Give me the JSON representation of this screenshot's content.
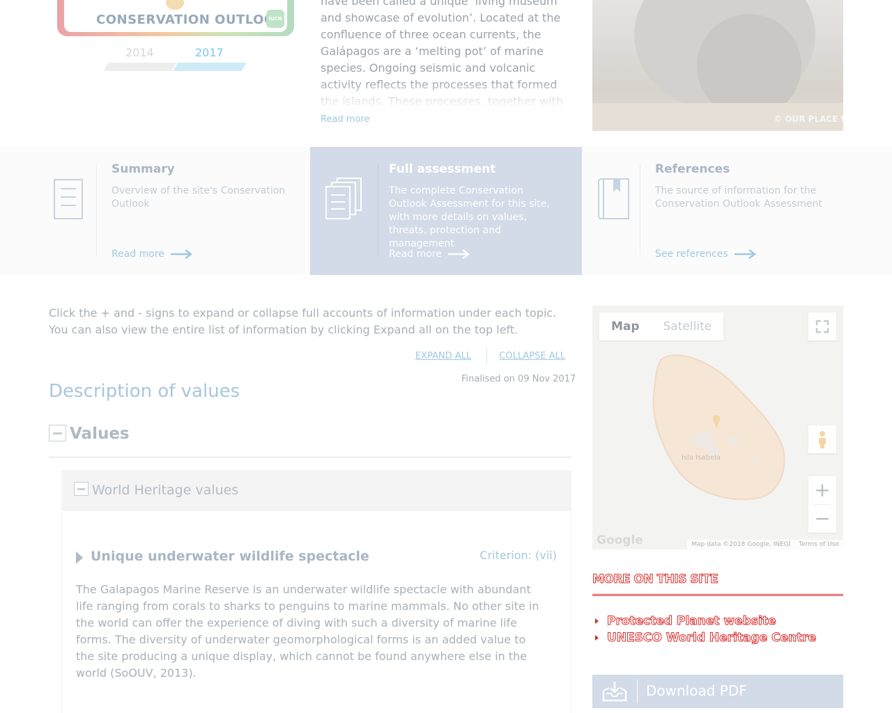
{
  "outlook": {
    "badge_title": "CONSERVATION OUTLOOK",
    "badge_logo": "IUCN",
    "years": [
      "2014",
      "2017"
    ],
    "selected_year": "2017"
  },
  "intro": {
    "text": "have been called a unique ‘living museum and showcase of evolution’. Located at the confluence of three ocean currents, the Galápagos are a ‘melting pot’ of marine species. Ongoing seismic and volcanic activity reflects the processes that formed the islands. These processes, together with",
    "read_more": "Read more"
  },
  "photo": {
    "credit": "© OUR PLACE WO"
  },
  "tabs": [
    {
      "title": "Summary",
      "desc": "Overview of the site's Conservation Outlook",
      "link": "Read more",
      "icon": "document-icon",
      "active": false
    },
    {
      "title": "Full assessment",
      "desc": "The complete Conservation Outlook Assessment for this site, with more details on values, threats, protection and management",
      "link": "Read more",
      "icon": "documents-stack-icon",
      "active": true
    },
    {
      "title": "References",
      "desc": "The source of information for the Conservation Outlook Assessment",
      "link": "See references",
      "icon": "book-icon",
      "active": false
    }
  ],
  "instructions": "Click the + and - signs to expand or collapse full accounts of information under each topic. You can also view the entire list of information by clicking Expand all on the top left.",
  "toggles": {
    "expand": "EXPAND ALL",
    "collapse": "COLLAPSE ALL"
  },
  "finalised": "Finalised on 09 Nov 2017",
  "section_heading": "Description of values",
  "values": {
    "title": "Values",
    "group_title": "World Heritage values",
    "item": {
      "title": "Unique underwater wildlife spectacle",
      "criterion": "Criterion: (vii)",
      "body": "The Galapagos Marine Reserve is an underwater wildlife spectacle with abundant life ranging from corals to sharks to penguins to marine mammals. No other site in the world can offer the experience of diving with such a diversity of marine life forms. The diversity of underwater geomorphological forms is an added value to the site producing a unique display, which cannot be found anywhere else in the world (SoOUV, 2013)."
    }
  },
  "map": {
    "map_tab": "Map",
    "satellite_tab": "Satellite",
    "active_tab": "Map",
    "place_label": "Isla Isabela",
    "google": "Google",
    "map_data": "Map data ©2018 Google, INEGI",
    "terms": "Terms of Use",
    "zoom_in": "+",
    "zoom_out": "−"
  },
  "more_on_site": {
    "heading": "MORE ON THIS SITE",
    "links": [
      "Protected Planet website",
      "UNESCO World Heritage Centre"
    ]
  },
  "download": {
    "label": "Download PDF"
  },
  "colors": {
    "accent_blue": "#9ec9df",
    "active_tab_bg": "#d2dbe7",
    "link_red": "#d82b2b"
  }
}
